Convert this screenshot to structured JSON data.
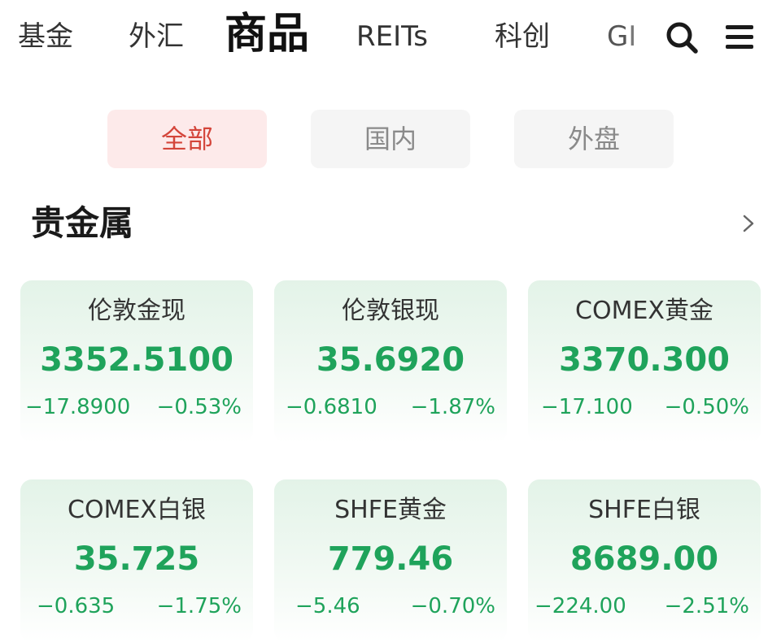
{
  "nav": {
    "tabs": [
      {
        "label": "基金"
      },
      {
        "label": "外汇"
      },
      {
        "label": "商品"
      },
      {
        "label": "REITs"
      },
      {
        "label": "科创"
      },
      {
        "label": "GI"
      }
    ],
    "active_index": 2,
    "icons": [
      "search-icon",
      "menu-icon"
    ]
  },
  "filters": {
    "options": [
      "全部",
      "国内",
      "外盘"
    ],
    "selected": "全部"
  },
  "section": {
    "title": "贵金属",
    "more_icon": "chevron-right-icon"
  },
  "quotes": [
    {
      "name": "伦敦金现",
      "price": "3352.5100",
      "change": "−17.8900",
      "pct": "−0.53%"
    },
    {
      "name": "伦敦银现",
      "price": "35.6920",
      "change": "−0.6810",
      "pct": "−1.87%"
    },
    {
      "name": "COMEX黄金",
      "price": "3370.300",
      "change": "−17.100",
      "pct": "−0.50%"
    },
    {
      "name": "COMEX白银",
      "price": "35.725",
      "change": "−0.635",
      "pct": "−1.75%"
    },
    {
      "name": "SHFE黄金",
      "price": "779.46",
      "change": "−5.46",
      "pct": "−0.70%"
    },
    {
      "name": "SHFE白银",
      "price": "8689.00",
      "change": "−224.00",
      "pct": "−2.51%"
    }
  ],
  "colors": {
    "down": "#1fa35b",
    "accent": "#d4453a",
    "accent_bg": "#fdeaea"
  }
}
